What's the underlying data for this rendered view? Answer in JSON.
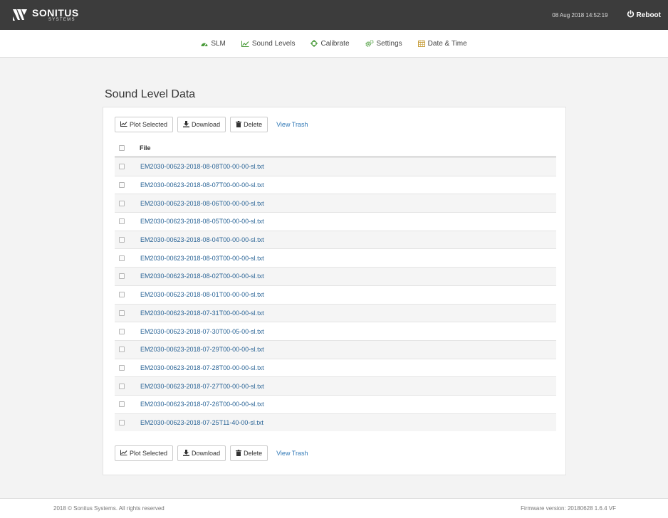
{
  "header": {
    "brand": "SONITUS",
    "brand_sub": "SYSTEMS",
    "datetime": "08 Aug 2018 14:52:19",
    "reboot_label": "Reboot"
  },
  "nav": {
    "items": [
      {
        "label": "SLM",
        "icon": "dashboard-icon"
      },
      {
        "label": "Sound Levels",
        "icon": "line-chart-icon"
      },
      {
        "label": "Calibrate",
        "icon": "crosshairs-icon"
      },
      {
        "label": "Settings",
        "icon": "cogs-icon"
      },
      {
        "label": "Date & Time",
        "icon": "calendar-icon"
      }
    ]
  },
  "page": {
    "title": "Sound Level Data"
  },
  "toolbar": {
    "plot_label": "Plot Selected",
    "download_label": "Download",
    "delete_label": "Delete",
    "trash_label": "View Trash"
  },
  "table": {
    "header_file": "File",
    "files": [
      "EM2030-00623-2018-08-08T00-00-00-sl.txt",
      "EM2030-00623-2018-08-07T00-00-00-sl.txt",
      "EM2030-00623-2018-08-06T00-00-00-sl.txt",
      "EM2030-00623-2018-08-05T00-00-00-sl.txt",
      "EM2030-00623-2018-08-04T00-00-00-sl.txt",
      "EM2030-00623-2018-08-03T00-00-00-sl.txt",
      "EM2030-00623-2018-08-02T00-00-00-sl.txt",
      "EM2030-00623-2018-08-01T00-00-00-sl.txt",
      "EM2030-00623-2018-07-31T00-00-00-sl.txt",
      "EM2030-00623-2018-07-30T00-05-00-sl.txt",
      "EM2030-00623-2018-07-29T00-00-00-sl.txt",
      "EM2030-00623-2018-07-28T00-00-00-sl.txt",
      "EM2030-00623-2018-07-27T00-00-00-sl.txt",
      "EM2030-00623-2018-07-26T00-00-00-sl.txt",
      "EM2030-00623-2018-07-25T11-40-00-sl.txt"
    ]
  },
  "footer": {
    "copyright": "2018 © Sonitus Systems. All rights reserved",
    "firmware": "Firmware version: 20180628 1.6.4 VF"
  },
  "colors": {
    "topbar": "#3c3c3c",
    "link": "#337ab7",
    "nav_icon_green": "#4a9b3a",
    "nav_icon_calendar": "#c8a040"
  }
}
